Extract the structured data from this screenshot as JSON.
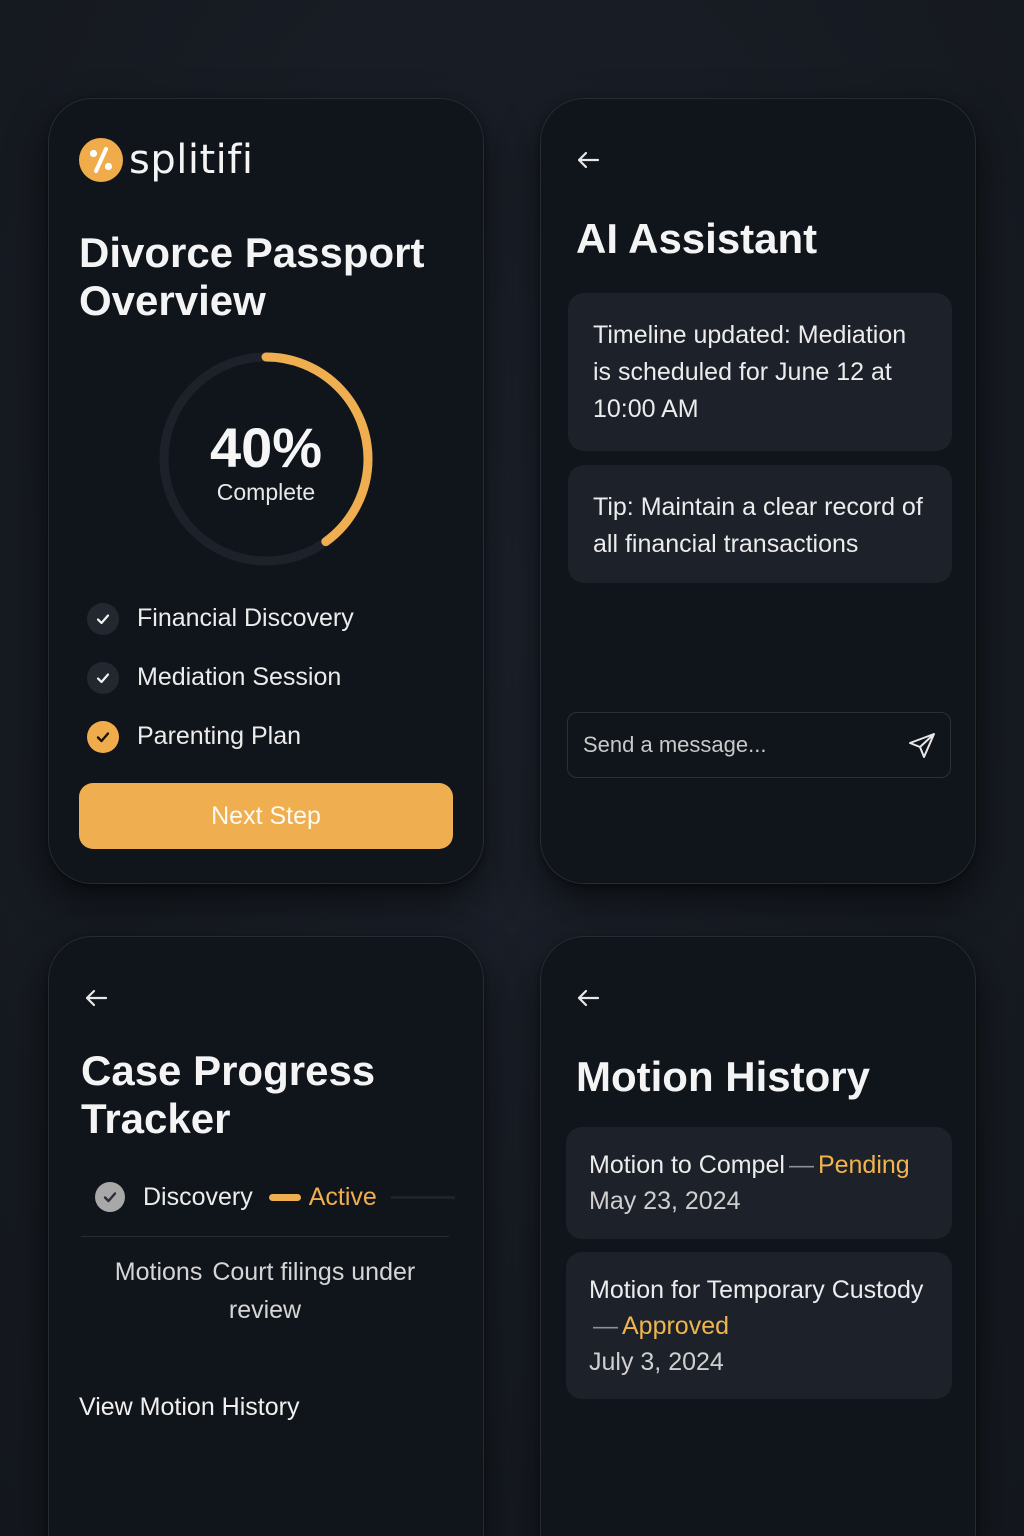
{
  "colors": {
    "background": "#181c24",
    "card": "#10141b",
    "accent": "#efae4f",
    "bubble": "#1c212a"
  },
  "overview": {
    "brand": "splitifi",
    "logo_icon": "percent-logo-icon",
    "title": "Divorce Passport Overview",
    "progress_percent": 40,
    "progress_text": "40%",
    "progress_label": "Complete",
    "steps": [
      {
        "label": "Financial Discovery",
        "icon": "check-icon",
        "state": "done"
      },
      {
        "label": "Mediation Session",
        "icon": "check-icon",
        "state": "done"
      },
      {
        "label": "Parenting Plan",
        "icon": "check-icon",
        "state": "current"
      }
    ],
    "next_button": "Next Step"
  },
  "assistant": {
    "back_icon": "arrow-left-icon",
    "title": "AI Assistant",
    "messages": [
      {
        "text": "Timeline updated: Mediation is scheduled for June 12 at 10:00 AM"
      },
      {
        "text": "Tip: Maintain a clear record of all financial transactions"
      }
    ],
    "composer": {
      "placeholder": "Send a message...",
      "value": "",
      "send_icon": "send-icon"
    }
  },
  "tracker": {
    "back_icon": "arrow-left-icon",
    "title": "Case Progress Tracker",
    "stage": {
      "label": "Discovery",
      "status": "Active",
      "icon": "check-circle-icon"
    },
    "description_key": "Motions",
    "description_text": "Court filings under review",
    "link": "View Motion History"
  },
  "motions": {
    "back_icon": "arrow-left-icon",
    "title": "Motion History",
    "items": [
      {
        "name": "Motion to Compel",
        "separator": "—",
        "status": "Pending",
        "date": "May 23, 2024"
      },
      {
        "name": "Motion for Temporary Custody",
        "separator": "—",
        "status": "Approved",
        "date": "July 3, 2024"
      }
    ]
  }
}
